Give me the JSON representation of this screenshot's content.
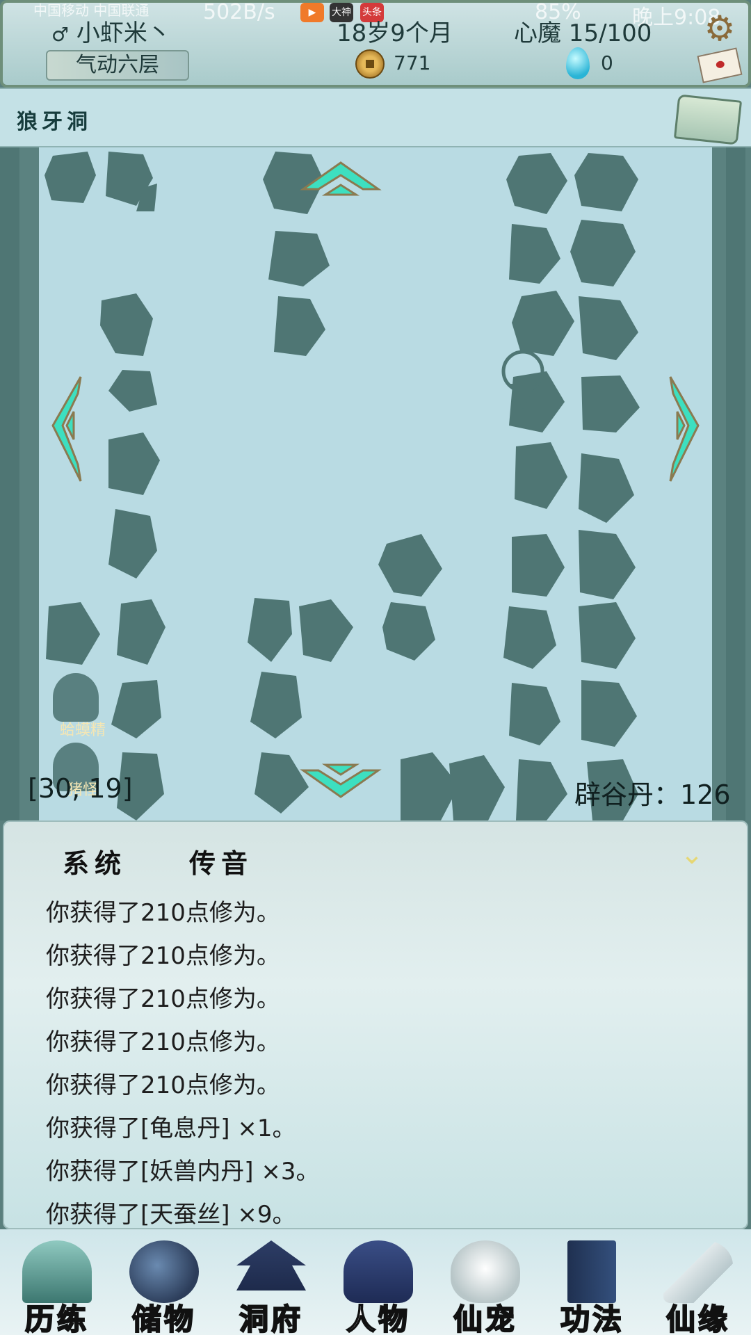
{
  "status_bar": {
    "carrier": "中国移动 中国联通",
    "net_speed": "502B/s",
    "app_badges": [
      "大神",
      "头条"
    ],
    "battery": "85%",
    "time": "晚上9:08"
  },
  "header": {
    "player_name": "小虾米丶",
    "realm": "气动六层",
    "age": "18岁9个月",
    "xinmo": "心魔  15/100",
    "coins": "771",
    "gems": "0"
  },
  "location": {
    "name": "狼牙洞"
  },
  "map": {
    "coords": "[30, 19]",
    "bigu_dan": "辟谷丹：126",
    "npcs": [
      {
        "label": "蛤蟆精"
      },
      {
        "label": "猪怪"
      }
    ]
  },
  "chat": {
    "tabs": [
      {
        "label": "系统"
      },
      {
        "label": "传音"
      }
    ],
    "active_tab": "系统",
    "messages": [
      "你获得了210点修为。",
      "你获得了210点修为。",
      "你获得了210点修为。",
      "你获得了210点修为。",
      "你获得了210点修为。",
      "你获得了[龟息丹] ×1。",
      "你获得了[妖兽内丹] ×3。",
      "你获得了[天蚕丝] ×9。"
    ]
  },
  "nav": {
    "items": [
      {
        "label": "历练",
        "icon": "mountain-icon"
      },
      {
        "label": "储物",
        "icon": "bag-icon"
      },
      {
        "label": "洞府",
        "icon": "pagoda-icon"
      },
      {
        "label": "人物",
        "icon": "person-icon"
      },
      {
        "label": "仙宠",
        "icon": "pet-icon"
      },
      {
        "label": "功法",
        "icon": "book-icon"
      },
      {
        "label": "仙缘",
        "icon": "crane-icon"
      }
    ]
  },
  "colors": {
    "map_floor": "#b9dbe3",
    "rock": "#4f7674",
    "arrow": "#3ddfc0",
    "wall": "#5a7f7d"
  }
}
